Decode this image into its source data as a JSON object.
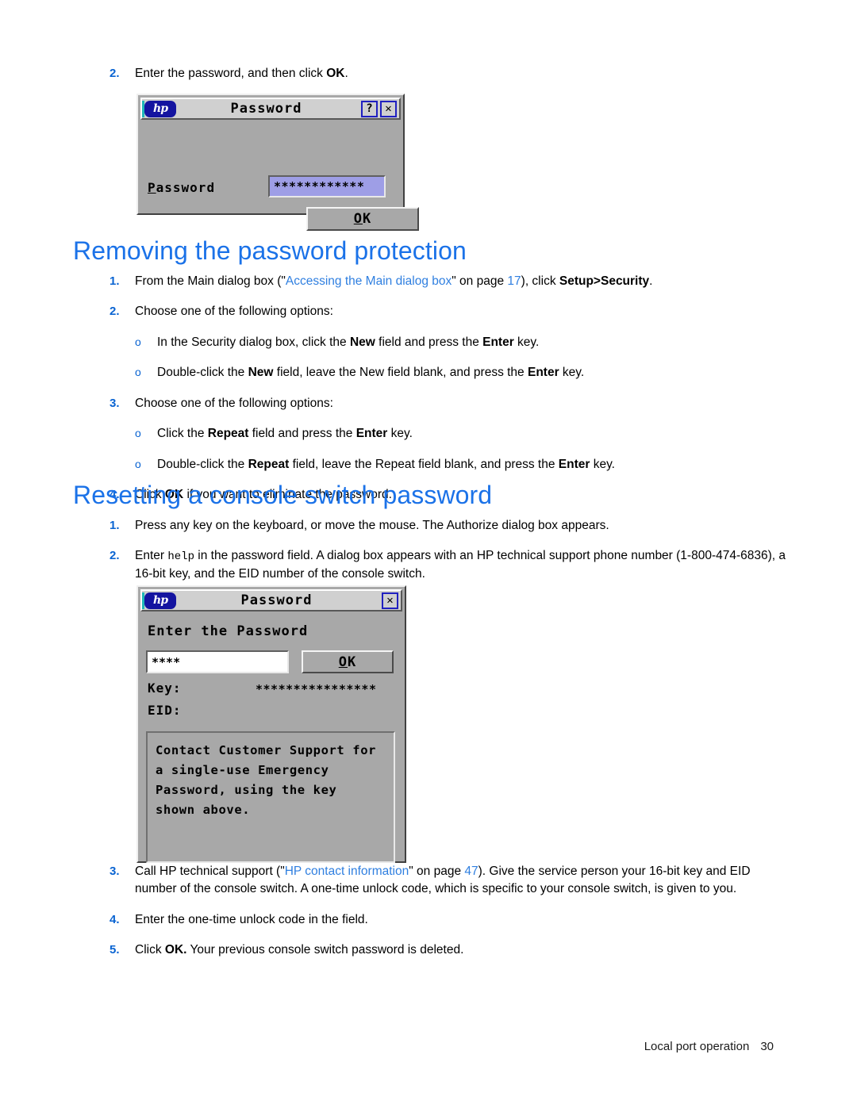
{
  "document": {
    "footer_label": "Local port operation",
    "footer_page": "30"
  },
  "intro_step": {
    "number": "2.",
    "text_before": "Enter the password, and then click ",
    "bold": "OK",
    "text_after": "."
  },
  "dialog1": {
    "name": "password-dialog",
    "logo_text": "hp",
    "title": "Password",
    "help_button": "?",
    "close_button": "✕",
    "field_label_first": "P",
    "field_label_rest": "assword",
    "field_value": "************",
    "ok_button_first": "O",
    "ok_button_rest": "K"
  },
  "section1": {
    "heading": "Removing the password protection",
    "steps": [
      {
        "number": "1.",
        "parts": [
          {
            "t": "From the Main dialog box (\"",
            "s": "plain"
          },
          {
            "t": "Accessing the Main dialog box",
            "s": "link"
          },
          {
            "t": "\" on page ",
            "s": "plain"
          },
          {
            "t": "17",
            "s": "pageref"
          },
          {
            "t": "), click ",
            "s": "plain"
          },
          {
            "t": "Setup>Security",
            "s": "bold"
          },
          {
            "t": ".",
            "s": "plain"
          }
        ]
      },
      {
        "number": "2.",
        "parts": [
          {
            "t": "Choose one of the following options:",
            "s": "plain"
          }
        ]
      }
    ],
    "sub_a": [
      {
        "bullet": "o",
        "parts": [
          {
            "t": "In the Security dialog box, click the ",
            "s": "plain"
          },
          {
            "t": "New",
            "s": "bold"
          },
          {
            "t": " field and press the ",
            "s": "plain"
          },
          {
            "t": "Enter",
            "s": "bold"
          },
          {
            "t": " key.",
            "s": "plain"
          }
        ]
      },
      {
        "bullet": "o",
        "parts": [
          {
            "t": "Double-click the ",
            "s": "plain"
          },
          {
            "t": "New",
            "s": "bold"
          },
          {
            "t": " field, leave the New field blank, and press the ",
            "s": "plain"
          },
          {
            "t": "Enter",
            "s": "bold"
          },
          {
            "t": " key.",
            "s": "plain"
          }
        ]
      }
    ],
    "step3": {
      "number": "3.",
      "parts": [
        {
          "t": "Choose one of the following options:",
          "s": "plain"
        }
      ]
    },
    "sub_b": [
      {
        "bullet": "o",
        "parts": [
          {
            "t": "Click the ",
            "s": "plain"
          },
          {
            "t": "Repeat",
            "s": "bold"
          },
          {
            "t": " field and press the ",
            "s": "plain"
          },
          {
            "t": "Enter",
            "s": "bold"
          },
          {
            "t": " key.",
            "s": "plain"
          }
        ]
      },
      {
        "bullet": "o",
        "parts": [
          {
            "t": "Double-click the ",
            "s": "plain"
          },
          {
            "t": "Repeat",
            "s": "bold"
          },
          {
            "t": " field, leave the Repeat field blank, and press the ",
            "s": "plain"
          },
          {
            "t": "Enter",
            "s": "bold"
          },
          {
            "t": " key.",
            "s": "plain"
          }
        ]
      }
    ],
    "step4": {
      "number": "4.",
      "parts": [
        {
          "t": "Click ",
          "s": "plain"
        },
        {
          "t": "OK",
          "s": "bold"
        },
        {
          "t": " if you want to eliminate the password.",
          "s": "plain"
        }
      ]
    }
  },
  "section2": {
    "heading": "Resetting a console switch password",
    "steps_top": [
      {
        "number": "1.",
        "parts": [
          {
            "t": "Press any key on the keyboard, or move the mouse. The Authorize dialog box appears.",
            "s": "plain"
          }
        ]
      },
      {
        "number": "2.",
        "parts": [
          {
            "t": "Enter ",
            "s": "plain"
          },
          {
            "t": "help",
            "s": "mono"
          },
          {
            "t": " in the password field. A dialog box appears with an HP technical support phone number (1-800-474-6836), a 16-bit key, and the EID number of the console switch.",
            "s": "plain"
          }
        ]
      }
    ],
    "steps_bottom": [
      {
        "number": "3.",
        "parts": [
          {
            "t": "Call HP technical support (\"",
            "s": "plain"
          },
          {
            "t": "HP contact information",
            "s": "link"
          },
          {
            "t": "\" on page ",
            "s": "plain"
          },
          {
            "t": "47",
            "s": "pageref"
          },
          {
            "t": "). Give the service person your 16-bit key and EID number of the console switch. A one-time unlock code, which is specific to your console switch, is given to you.",
            "s": "plain"
          }
        ]
      },
      {
        "number": "4.",
        "parts": [
          {
            "t": "Enter the one-time unlock code in the field.",
            "s": "plain"
          }
        ]
      },
      {
        "number": "5.",
        "parts": [
          {
            "t": "Click ",
            "s": "plain"
          },
          {
            "t": "OK.",
            "s": "bold"
          },
          {
            "t": " Your previous console switch password is deleted.",
            "s": "plain"
          }
        ]
      }
    ]
  },
  "dialog2": {
    "name": "enter-password-dialog",
    "logo_text": "hp",
    "title": "Password",
    "close_button": "✕",
    "prompt": "Enter the Password",
    "input_value": "****",
    "ok_button_first": "O",
    "ok_button_rest": "K",
    "key_label": "Key:",
    "key_value": "****************",
    "eid_label": "EID:",
    "eid_value": "",
    "message_lines": [
      "Contact Customer Support for",
      "a single-use Emergency",
      "Password, using the key",
      "shown above."
    ]
  },
  "colors": {
    "heading_blue": "#1b72e8",
    "link_blue": "#2f7fe0",
    "number_blue": "#0a64d2",
    "dialog_gray": "#a8a8a8",
    "password_field": "#9e9ee6",
    "hp_logo_blue": "#1414a0"
  }
}
